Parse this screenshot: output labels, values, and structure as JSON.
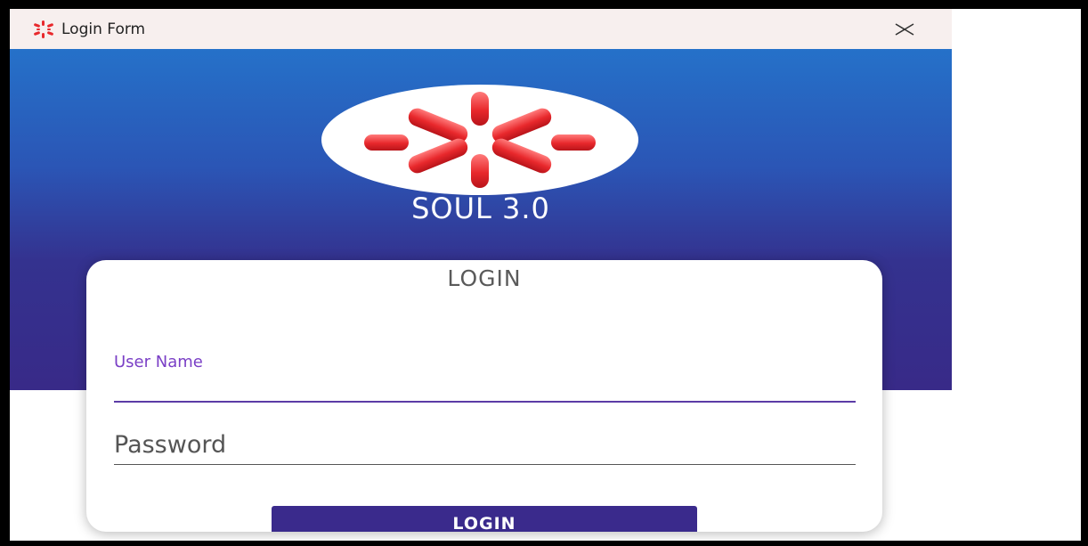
{
  "window": {
    "title": "Login Form",
    "icon": "soul-logo-icon",
    "close_icon": "close-icon"
  },
  "hero": {
    "brand": "SOUL 3.0",
    "logo": "soul-logo"
  },
  "login_card": {
    "title": "LOGIN",
    "username_label": "User Name",
    "username_value": "",
    "password_placeholder": "Password",
    "password_value": "",
    "login_button": "LOGIN"
  },
  "colors": {
    "gradient_top": "#2571c9",
    "gradient_bottom": "#382a88",
    "accent_purple": "#5b3ba6",
    "label_purple": "#7a3fc6",
    "button_bg": "#3a2a8c",
    "logo_red": "#e8282c"
  }
}
